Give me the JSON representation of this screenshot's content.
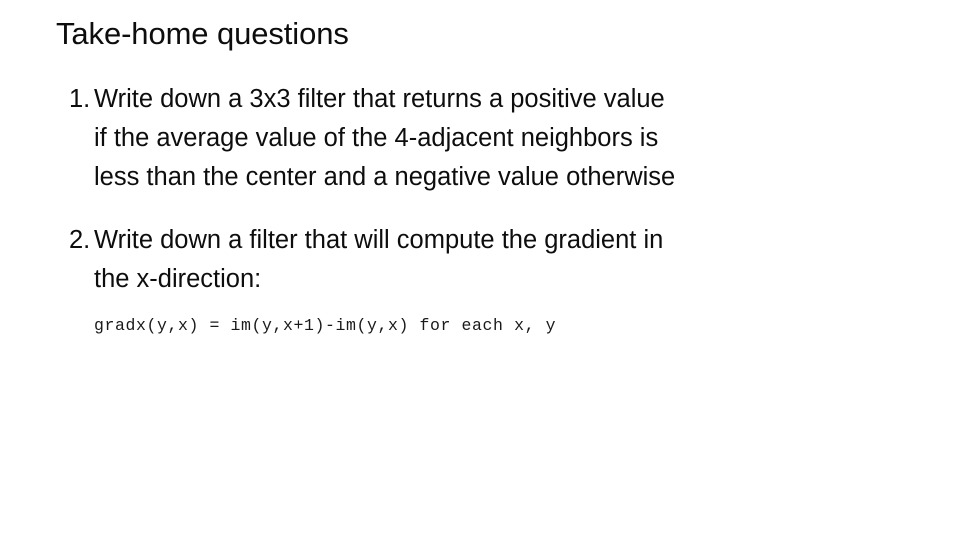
{
  "slide": {
    "title": "Take-home questions",
    "questions": [
      {
        "marker": "1.",
        "text": "Write down a 3x3 filter that returns a positive value if the average value of the 4-adjacent neighbors is less than the center and a negative value otherwise"
      },
      {
        "marker": "2.",
        "text": "Write down a filter that will compute the gradient in the x-direction:",
        "code": "gradx(y,x) = im(y,x+1)-im(y,x) for each x, y"
      }
    ],
    "colors": {
      "background": "#ffffff",
      "text": "#0d0d0d",
      "code_text": "#1a1a1a"
    }
  }
}
